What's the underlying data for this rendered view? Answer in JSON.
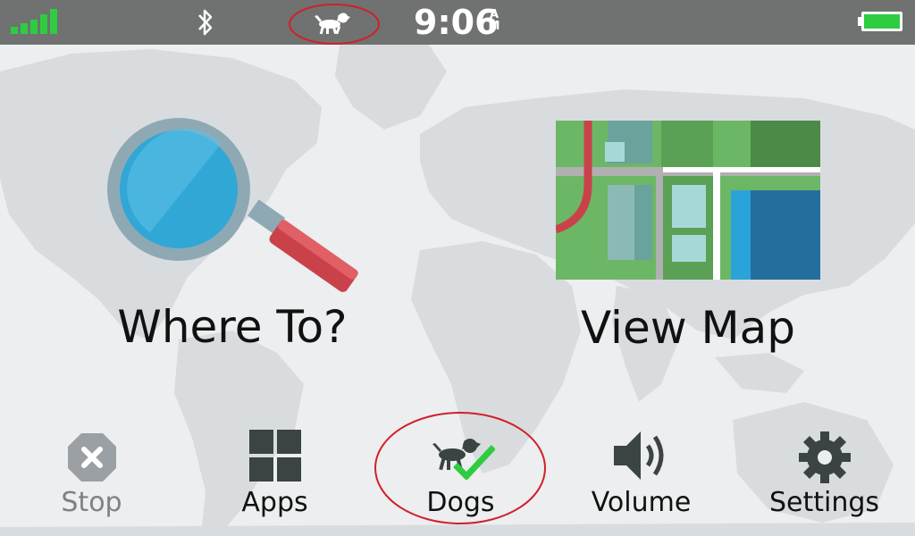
{
  "status_bar": {
    "time": "9:06",
    "ampm_top": "A",
    "ampm_bottom": "M",
    "icons": [
      "signal-strength-icon",
      "bluetooth-icon",
      "dog-tracking-icon",
      "battery-icon"
    ],
    "signal_color": "#2ecc40",
    "battery_color": "#2ecc40",
    "highlight_color": "#d0202a"
  },
  "main": {
    "where_to": {
      "label": "Where To?",
      "icon": "magnifier-icon"
    },
    "view_map": {
      "label": "View Map",
      "icon": "map-icon"
    }
  },
  "dock": {
    "items": [
      {
        "label": "Stop",
        "icon": "close-icon",
        "state": "disabled"
      },
      {
        "label": "Apps",
        "icon": "grid-icon"
      },
      {
        "label": "Dogs",
        "icon": "dog-check-icon",
        "highlighted": true
      },
      {
        "label": "Volume",
        "icon": "speaker-icon"
      },
      {
        "label": "Settings",
        "icon": "gear-icon"
      }
    ]
  }
}
